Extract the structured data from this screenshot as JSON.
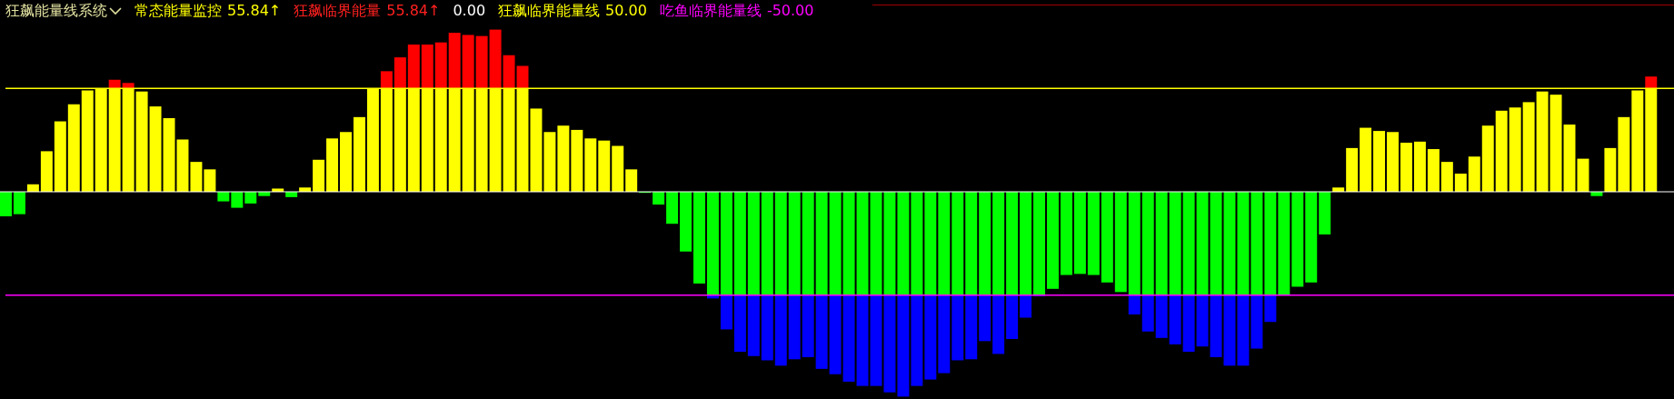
{
  "indicator": {
    "title": "狂飙能量线系统"
  },
  "legend": [
    {
      "label": "常态能量监控",
      "value": "55.84",
      "arrow": "↑",
      "color": "#ffff00"
    },
    {
      "label": "狂飙临界能量",
      "value": "55.84",
      "arrow": "↑",
      "color": "#ff2020"
    },
    {
      "value": "0.00",
      "color": "#ffffff"
    },
    {
      "label": "狂飙临界能量线",
      "value": "50.00",
      "color": "#ffff00"
    },
    {
      "label": "吃鱼临界能量线",
      "value": "-50.00",
      "color": "#ff00ff"
    }
  ]
}
